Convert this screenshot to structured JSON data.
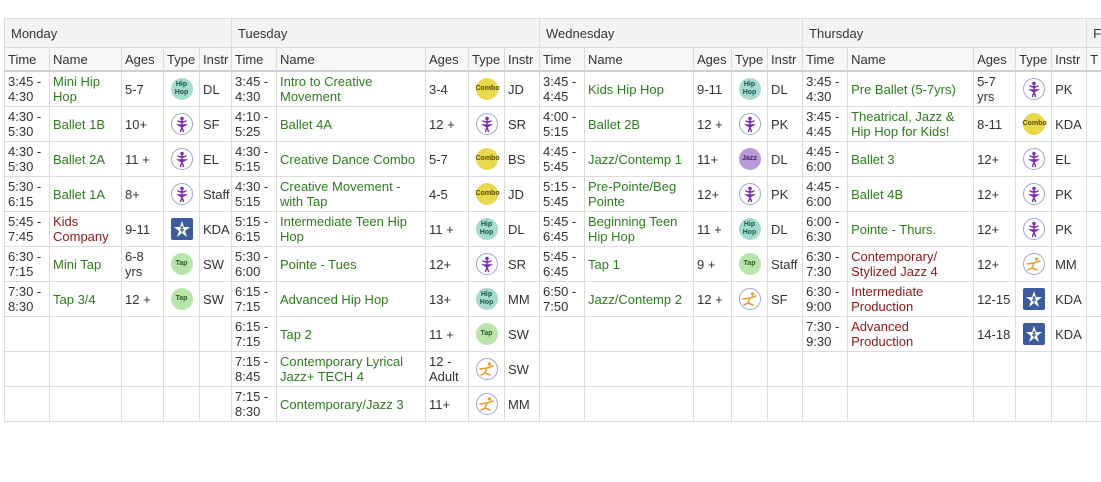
{
  "days": [
    "Monday",
    "Tuesday",
    "Wednesday",
    "Thursday",
    "F"
  ],
  "columns": [
    "Time",
    "Name",
    "Ages",
    "Type",
    "Instr"
  ],
  "last_col_header": "T",
  "colors": {
    "name_green": "#2e7d1d",
    "name_red": "#8b1a1a"
  },
  "rows": [
    [
      {
        "time": "3:45 - 4:30",
        "name": "Mini Hip Hop",
        "ages": "5-7",
        "type": "hiphop",
        "instr": "DL"
      },
      {
        "time": "3:45 - 4:30",
        "name": "Intro to Creative Movement",
        "ages": "3-4",
        "type": "combo",
        "instr": "JD"
      },
      {
        "time": "3:45 - 4:45",
        "name": "Kids Hip Hop",
        "ages": "9-11",
        "type": "hiphop",
        "instr": "DL"
      },
      {
        "time": "3:45 - 4:30",
        "name": "Pre Ballet (5-7yrs)",
        "ages": "5-7 yrs",
        "type": "ballet",
        "instr": "PK"
      }
    ],
    [
      {
        "time": "4:30 - 5:30",
        "name": "Ballet 1B",
        "ages": "10+",
        "type": "ballet",
        "instr": "SF"
      },
      {
        "time": "4:10 - 5:25",
        "name": "Ballet 4A",
        "ages": "12 +",
        "type": "ballet",
        "instr": "SR"
      },
      {
        "time": "4:00 - 5:15",
        "name": "Ballet 2B",
        "ages": "12 +",
        "type": "ballet",
        "instr": "PK"
      },
      {
        "time": "3:45 - 4:45",
        "name": "Theatrical, Jazz & Hip Hop for Kids!",
        "ages": "8-11",
        "type": "combo",
        "instr": "KDA"
      }
    ],
    [
      {
        "time": "4:30 - 5:30",
        "name": "Ballet 2A",
        "ages": "11 +",
        "type": "ballet",
        "instr": "EL"
      },
      {
        "time": "4:30 - 5:15",
        "name": "Creative Dance Combo",
        "ages": "5-7",
        "type": "combo",
        "instr": "BS"
      },
      {
        "time": "4:45 - 5:45",
        "name": "Jazz/Contemp 1",
        "ages": "11+",
        "type": "jazz",
        "instr": "DL"
      },
      {
        "time": "4:45 - 6:00",
        "name": "Ballet 3",
        "ages": "12+",
        "type": "ballet",
        "instr": "EL"
      }
    ],
    [
      {
        "time": "5:30 - 6:15",
        "name": "Ballet 1A",
        "ages": "8+",
        "type": "ballet",
        "instr": "Staff"
      },
      {
        "time": "4:30 - 5:15",
        "name": "Creative Movement - with Tap",
        "ages": "4-5",
        "type": "combo",
        "instr": "JD"
      },
      {
        "time": "5:15 - 5:45",
        "name": "Pre-Pointe/Beg Pointe",
        "ages": "12+",
        "type": "ballet",
        "instr": "PK"
      },
      {
        "time": "4:45 - 6:00",
        "name": "Ballet 4B",
        "ages": "12+",
        "type": "ballet",
        "instr": "PK"
      }
    ],
    [
      {
        "time": "5:45 - 7:45",
        "name": "Kids Company",
        "ages": "9-11",
        "type": "production",
        "instr": "KDA",
        "red": true
      },
      {
        "time": "5:15 - 6:15",
        "name": "Intermediate Teen Hip Hop",
        "ages": "11 +",
        "type": "hiphop",
        "instr": "DL"
      },
      {
        "time": "5:45 - 6:45",
        "name": "Beginning Teen Hip Hop",
        "ages": "11 +",
        "type": "hiphop",
        "instr": "DL"
      },
      {
        "time": "6:00 - 6:30",
        "name": "Pointe - Thurs.",
        "ages": "12+",
        "type": "ballet",
        "instr": "PK"
      }
    ],
    [
      {
        "time": "6:30 - 7:15",
        "name": "Mini Tap",
        "ages": "6-8 yrs",
        "type": "tap",
        "instr": "SW"
      },
      {
        "time": "5:30 - 6:00",
        "name": "Pointe - Tues",
        "ages": "12+",
        "type": "ballet",
        "instr": "SR"
      },
      {
        "time": "5:45 - 6:45",
        "name": "Tap 1",
        "ages": "9 +",
        "type": "tap",
        "instr": "Staff"
      },
      {
        "time": "6:30 - 7:30",
        "name": "Contemporary/ Stylized Jazz 4",
        "ages": "12+",
        "type": "contemporary",
        "instr": "MM",
        "red": true
      }
    ],
    [
      {
        "time": "7:30 - 8:30",
        "name": "Tap 3/4",
        "ages": "12 +",
        "type": "tap",
        "instr": "SW"
      },
      {
        "time": "6:15 - 7:15",
        "name": "Advanced Hip Hop",
        "ages": "13+",
        "type": "hiphop",
        "instr": "MM"
      },
      {
        "time": "6:50 - 7:50",
        "name": "Jazz/Contemp 2",
        "ages": "12 +",
        "type": "contemporary",
        "instr": "SF"
      },
      {
        "time": "6:30 - 9:00",
        "name": "Intermediate Production",
        "ages": "12-15",
        "type": "production",
        "instr": "KDA",
        "red": true
      }
    ],
    [
      null,
      {
        "time": "6:15 - 7:15",
        "name": "Tap 2",
        "ages": "11 +",
        "type": "tap",
        "instr": "SW"
      },
      null,
      {
        "time": "7:30 - 9:30",
        "name": "Advanced Production",
        "ages": "14-18",
        "type": "production",
        "instr": "KDA",
        "red": true
      }
    ],
    [
      null,
      {
        "time": "7:15 - 8:45",
        "name": "Contemporary Lyrical Jazz+ TECH 4",
        "ages": "12 - Adult",
        "type": "contemporary",
        "instr": "SW"
      },
      null,
      null
    ],
    [
      null,
      {
        "time": "7:15 - 8:30",
        "name": "Contemporary/Jazz 3",
        "ages": "11+",
        "type": "contemporary",
        "instr": "MM"
      },
      null,
      null
    ]
  ],
  "type_icons": {
    "hiphop": {
      "icon": "hip-hop-icon",
      "label": "Hip Hop"
    },
    "combo": {
      "icon": "combo-icon",
      "label": "Combo"
    },
    "jazz": {
      "icon": "jazz-icon",
      "label": "Jazz"
    },
    "tap": {
      "icon": "tap-icon",
      "label": "Tap"
    },
    "ballet": {
      "icon": "ballerina-icon",
      "label": ""
    },
    "contemporary": {
      "icon": "contemporary-dancer-icon",
      "label": ""
    },
    "production": {
      "icon": "star-performer-icon",
      "label": ""
    }
  }
}
